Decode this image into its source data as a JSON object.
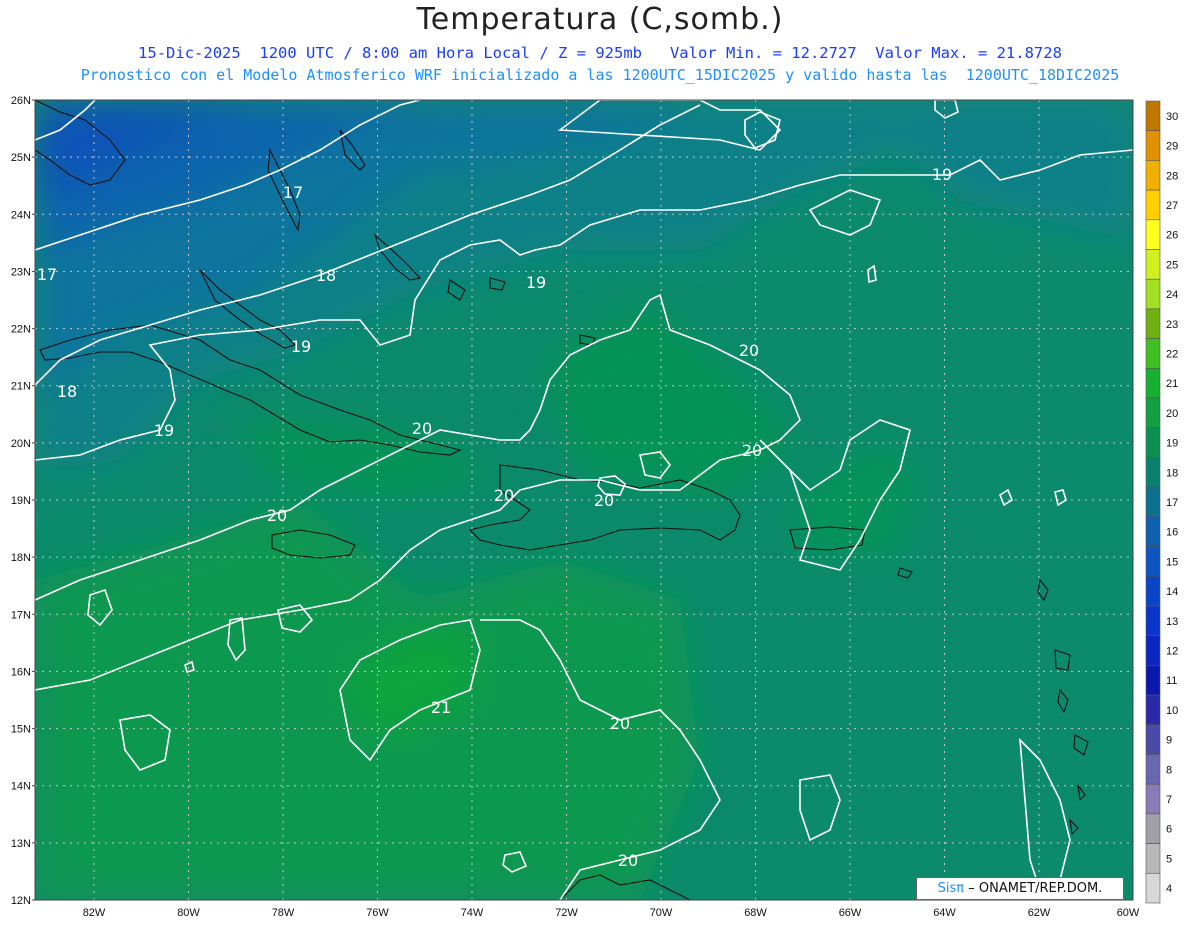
{
  "header": {
    "title": "Temperatura (C,somb.)",
    "line1": "15-Dic-2025  1200 UTC / 8:00 am Hora Local / Z = 925mb   Valor Min. = 12.2727  Valor Max. = 21.8728",
    "line2": "Pronostico con el Modelo Atmosferico WRF inicializado a las 1200UTC_15DIC2025 y valido hasta las  1200UTC_18DIC2025"
  },
  "map": {
    "lat_labels": [
      "26N",
      "25N",
      "24N",
      "23N",
      "22N",
      "21N",
      "20N",
      "19N",
      "18N",
      "17N",
      "16N",
      "15N",
      "14N",
      "13N",
      "12N"
    ],
    "lon_labels": [
      "82W",
      "80W",
      "78W",
      "76W",
      "74W",
      "72W",
      "70W",
      "68W",
      "66W",
      "64W",
      "62W",
      "60W"
    ],
    "contour_labels": [
      {
        "text": "17"
      },
      {
        "text": "17"
      },
      {
        "text": "18"
      },
      {
        "text": "18"
      },
      {
        "text": "19"
      },
      {
        "text": "19"
      },
      {
        "text": "19"
      },
      {
        "text": "19"
      },
      {
        "text": "20"
      },
      {
        "text": "20"
      },
      {
        "text": "20"
      },
      {
        "text": "20"
      },
      {
        "text": "20"
      },
      {
        "text": "20"
      },
      {
        "text": "20"
      },
      {
        "text": "20"
      },
      {
        "text": "21"
      }
    ],
    "colors": {
      "level_16": "#0a52b8",
      "level_17": "#0d63ad",
      "level_18": "#0f749e",
      "level_19": "#0e8088",
      "level_20": "#0c8a6c",
      "level_21": "#0a9a4a",
      "level_22": "#0aa63a"
    }
  },
  "colorbar": {
    "labels": [
      "30",
      "29",
      "28",
      "27",
      "26",
      "25",
      "24",
      "23",
      "22",
      "21",
      "20",
      "19",
      "18",
      "17",
      "16",
      "15",
      "14",
      "13",
      "12",
      "11",
      "10",
      "9",
      "8",
      "7",
      "6",
      "5",
      "4"
    ],
    "colors": [
      "#c07800",
      "#e09000",
      "#f0b000",
      "#ffd000",
      "#ffff20",
      "#d0f020",
      "#a0e020",
      "#70b010",
      "#40c020",
      "#18b030",
      "#10a040",
      "#0c9050",
      "#0c8070",
      "#0e7090",
      "#1060b0",
      "#0d55c0",
      "#0a45c8",
      "#0a35c8",
      "#0a25c0",
      "#0a18b0",
      "#2a2aa8",
      "#4a4aa8",
      "#6868b0",
      "#8a7ab8",
      "#a0a0a8",
      "#b8b8b8",
      "#d8d8d8"
    ]
  },
  "credit": {
    "sis": "Sisπ",
    "rest": "– ONAMET/REP.DOM."
  }
}
